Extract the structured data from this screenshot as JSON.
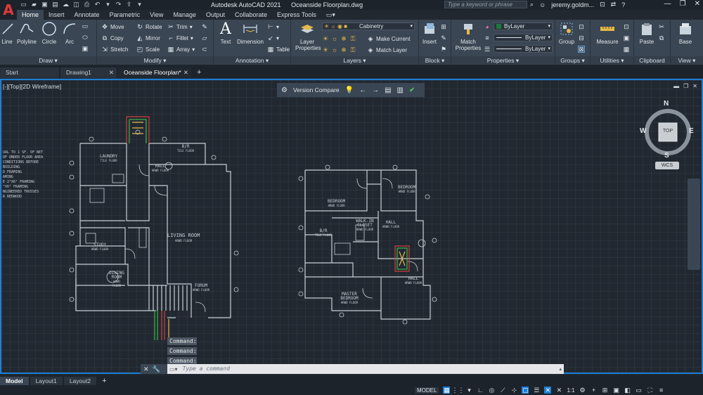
{
  "app": {
    "title": "Autodesk AutoCAD 2021",
    "file": "Oceanside Floorplan.dwg",
    "logo_letter": "A",
    "search_placeholder": "Type a keyword or phrase",
    "user": "jeremy.goldm...",
    "accent": "#1e7fd6"
  },
  "ribbon_tabs": [
    "Home",
    "Insert",
    "Annotate",
    "Parametric",
    "View",
    "Manage",
    "Output",
    "Collaborate",
    "Express Tools"
  ],
  "ribbon": {
    "draw": {
      "label": "Draw",
      "tools": [
        "Line",
        "Polyline",
        "Circle",
        "Arc"
      ]
    },
    "modify": {
      "label": "Modify",
      "tools": [
        "Move",
        "Rotate",
        "Trim",
        "Copy",
        "Mirror",
        "Fillet",
        "Stretch",
        "Scale",
        "Array"
      ]
    },
    "annotation": {
      "label": "Annotation",
      "tools": [
        "Text",
        "Dimension",
        "Table"
      ]
    },
    "layers": {
      "label": "Layers",
      "layer_properties": "Layer Properties",
      "current_layer": "Cabinetry",
      "make_current": "Make Current",
      "match_layer": "Match Layer"
    },
    "block": {
      "label": "Block",
      "insert": "Insert"
    },
    "properties": {
      "label": "Properties",
      "match": "Match Properties",
      "color": "ByLayer",
      "linetype": "ByLayer",
      "lineweight": "ByLayer"
    },
    "groups": {
      "label": "Groups",
      "group": "Group"
    },
    "utilities": {
      "label": "Utilities",
      "measure": "Measure"
    },
    "clipboard": {
      "label": "Clipboard",
      "paste": "Paste"
    },
    "view": {
      "label": "View",
      "base": "Base"
    }
  },
  "doc_tabs": [
    {
      "label": "Start",
      "closable": false
    },
    {
      "label": "Drawing1",
      "closable": true
    },
    {
      "label": "Oceanside Floorplan*",
      "closable": true
    }
  ],
  "viewport": {
    "label": "[-][Top][2D Wireframe]",
    "version_compare": "Version Compare",
    "viewcube": {
      "n": "N",
      "s": "S",
      "e": "E",
      "w": "W",
      "face": "TOP",
      "wcs": "WCS"
    }
  },
  "drawing": {
    "notes": [
      "UAL TO 1 SF. OF NET",
      "OF UNDER FLOOR AREA",
      "CONDITIONS BEFORE",
      "BUILDING",
      "D FRAMING",
      "AMING",
      "E 2\"X6\" FRAMING",
      "\"X6\" FRAMING",
      "NGINEERED TRUSSES",
      "",
      "R REDWOOD"
    ],
    "rooms_left": [
      {
        "name": "LAUNDRY",
        "sub": "TILE FLOOR"
      },
      {
        "name": "B/R",
        "sub": "TILE FLOOR"
      },
      {
        "name": "HALL",
        "sub": "HRWD FLOOR"
      },
      {
        "name": "LIVING ROOM",
        "sub": "HRWD FLOOR"
      },
      {
        "name": "STUDY",
        "sub": "HRWD FLOOR"
      },
      {
        "name": "DINING ROOM",
        "sub": "HRWD FLOOR"
      },
      {
        "name": "FORUM",
        "sub": "HRWD FLOOR"
      }
    ],
    "rooms_right": [
      {
        "name": "BEDROOM",
        "sub": "HRWD FLOOR"
      },
      {
        "name": "BEDROOM",
        "sub": "HRWD FLOOR"
      },
      {
        "name": "WALK-IN CLOSET",
        "sub": "HRWD FLOOR"
      },
      {
        "name": "B/R",
        "sub": "TILE FLOOR"
      },
      {
        "name": "HALL",
        "sub": "HRWD FLOOR"
      },
      {
        "name": "HALL",
        "sub": "HRWD FLOOR"
      },
      {
        "name": "MASTER BEDROOM",
        "sub": "HRWD FLOOR"
      }
    ]
  },
  "command": {
    "history": [
      "Command:",
      "Command:",
      "Command:"
    ],
    "placeholder": "Type a command"
  },
  "layout_tabs": [
    "Model",
    "Layout1",
    "Layout2"
  ],
  "status": {
    "model": "MODEL",
    "scale": "1:1"
  }
}
